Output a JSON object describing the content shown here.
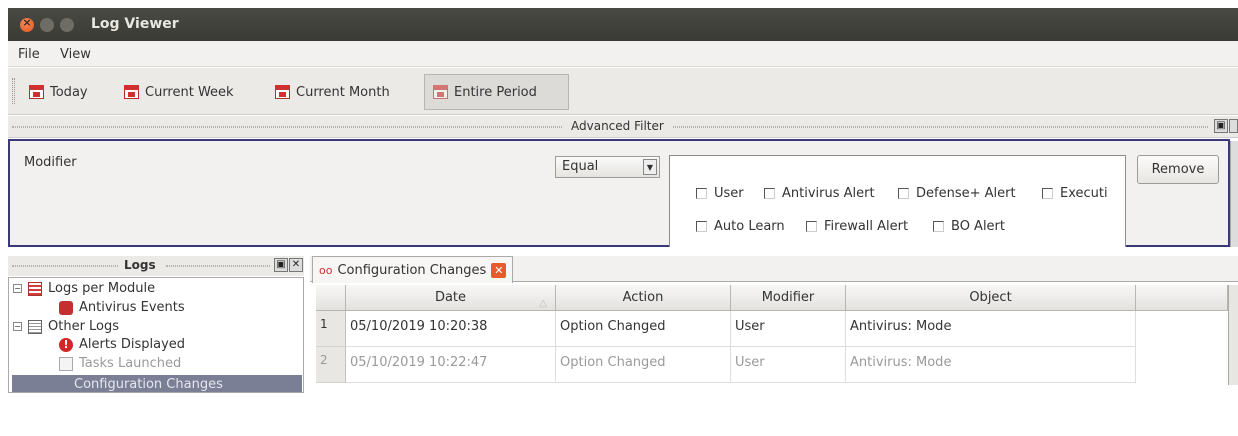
{
  "window": {
    "title": "Log Viewer"
  },
  "menu": {
    "file": "File",
    "view": "View"
  },
  "toolbar": {
    "today": "Today",
    "current_week": "Current Week",
    "current_month": "Current Month",
    "entire_period": "Entire Period"
  },
  "filter": {
    "title": "Advanced Filter",
    "modifier_label": "Modifier",
    "operator": "Equal",
    "options": [
      "User",
      "Antivirus Alert",
      "Defense+ Alert",
      "Executi",
      "Auto Learn",
      "Firewall Alert",
      "BO Alert"
    ],
    "remove_label": "Remove"
  },
  "logs_panel": {
    "title": "Logs",
    "tree": {
      "logs_per_module": "Logs per Module",
      "antivirus_events": "Antivirus Events",
      "other_logs": "Other Logs",
      "alerts_displayed": "Alerts Displayed",
      "tasks_launched": "Tasks Launched",
      "configuration_changes": "Configuration Changes"
    }
  },
  "tab": {
    "label": "Configuration Changes"
  },
  "table": {
    "columns": [
      "Date",
      "Action",
      "Modifier",
      "Object"
    ],
    "rows": [
      {
        "num": "1",
        "date": "05/10/2019 10:20:38",
        "action": "Option Changed",
        "modifier": "User",
        "object": "Antivirus: Mode"
      },
      {
        "num": "2",
        "date": "05/10/2019 10:22:47",
        "action": "Option Changed",
        "modifier": "User",
        "object": "Antivirus: Mode"
      }
    ]
  },
  "colors": {
    "titlebar": "#3e3e39",
    "close_button": "#e0541f",
    "selection": "#7b7f95",
    "filter_border": "#3a3a7a"
  }
}
